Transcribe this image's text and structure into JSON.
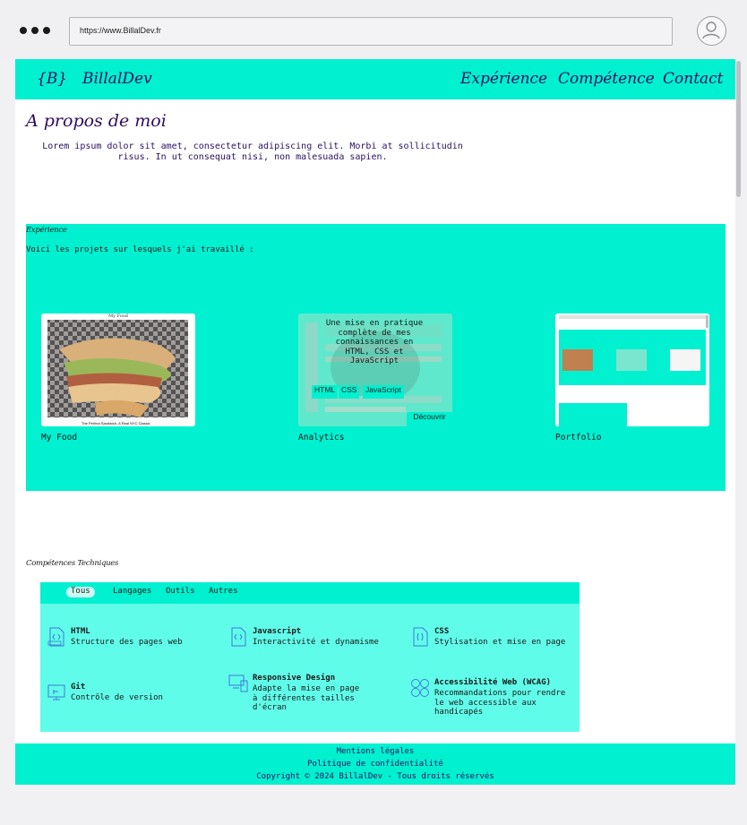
{
  "browser": {
    "url": "https://www.BillalDev.fr"
  },
  "nav": {
    "logo": "{B}",
    "brand": "BillalDev",
    "links": [
      "Expérience",
      "Compétence",
      "Contact"
    ]
  },
  "about": {
    "title": "A propos de moi",
    "text": "Lorem ipsum dolor sit amet, consectetur adipiscing elit. Morbi at  sollicitudin risus. In ut consequat nisi, non malesuada sapien."
  },
  "experience": {
    "title": "Expérience",
    "intro": "Voici les projets sur lesquels j'ai travaillé :",
    "projects": [
      {
        "title": "My Food",
        "thumb_caption": "My Food"
      },
      {
        "title": "Analytics",
        "overlay_text": "Une mise en pratique complète de mes connaissances en HTML, CSS et JavaScript",
        "tags": [
          "HTML",
          "CSS",
          "JavaScript"
        ],
        "button": "Découvrir"
      },
      {
        "title": "Portfolio"
      }
    ]
  },
  "skills": {
    "title": "Compétences Techniques",
    "tabs": [
      "Tous",
      "Langages",
      "Outils",
      "Autres"
    ],
    "active_tab": "Tous",
    "items": [
      {
        "name": "HTML",
        "desc": "Structure des pages web",
        "icon": "html-file-icon"
      },
      {
        "name": "Javascript",
        "desc": "Interactivité et dynamisme",
        "icon": "js-file-icon"
      },
      {
        "name": "CSS",
        "desc": "Stylisation et mise en page",
        "icon": "css-file-icon"
      },
      {
        "name": "Git",
        "desc": "Contrôle de version",
        "icon": "git-monitor-icon"
      },
      {
        "name": "Responsive Design",
        "desc": "Adapte la mise en page à différentes tailles d'écran",
        "icon": "responsive-devices-icon"
      },
      {
        "name": "Accessibilité Web (WCAG)",
        "desc": "Recommandations pour rendre le web accessible aux handicapés",
        "icon": "accessibility-icon"
      }
    ]
  },
  "footer": {
    "links": [
      "Mentions légales",
      "Politique de confidentialité"
    ],
    "copyright": "Copyright © 2024 BillalDev - Tous droits réservés"
  },
  "colors": {
    "accent": "#00f0d0",
    "accent_light": "#60fcea",
    "text_purple": "#2a1060"
  }
}
